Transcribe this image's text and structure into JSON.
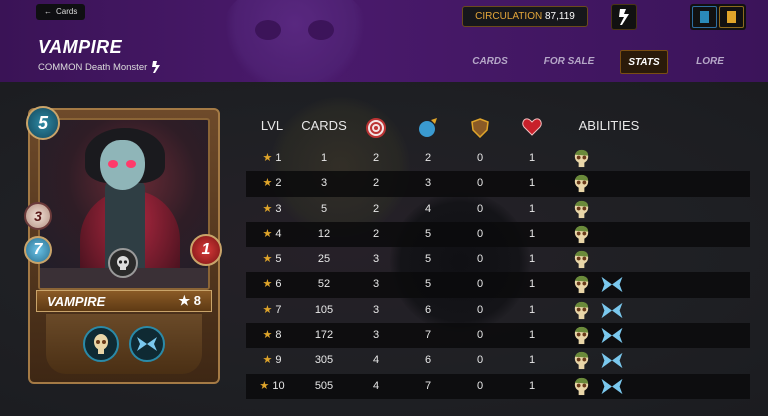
{
  "header": {
    "back_label": "Cards",
    "title": "VAMPIRE",
    "subtitle": "COMMON Death Monster",
    "circulation_label": "CIRCULATION",
    "circulation_value": "87,119",
    "tabs": [
      {
        "label": "CARDS",
        "active": false
      },
      {
        "label": "FOR SALE",
        "active": false
      },
      {
        "label": "STATS",
        "active": true
      },
      {
        "label": "LORE",
        "active": false
      }
    ]
  },
  "card": {
    "mana": "5",
    "attack": "3",
    "speed": "7",
    "health": "1",
    "name": "VAMPIRE",
    "level": "★ 8",
    "abilities": [
      "skull-ability-icon",
      "wings-ability-icon"
    ]
  },
  "table": {
    "headers": {
      "lvl": "LVL",
      "cards": "CARDS",
      "abilities": "ABILITIES"
    },
    "header_icons": [
      "target-icon",
      "speed-orb-icon",
      "shield-icon",
      "heart-icon"
    ],
    "rows": [
      {
        "lvl": "1",
        "cards": "1",
        "attack": "2",
        "speed": "2",
        "armor": "0",
        "health": "1",
        "abilities": [
          "skull"
        ]
      },
      {
        "lvl": "2",
        "cards": "3",
        "attack": "2",
        "speed": "3",
        "armor": "0",
        "health": "1",
        "abilities": [
          "skull"
        ]
      },
      {
        "lvl": "3",
        "cards": "5",
        "attack": "2",
        "speed": "4",
        "armor": "0",
        "health": "1",
        "abilities": [
          "skull"
        ]
      },
      {
        "lvl": "4",
        "cards": "12",
        "attack": "2",
        "speed": "5",
        "armor": "0",
        "health": "1",
        "abilities": [
          "skull"
        ]
      },
      {
        "lvl": "5",
        "cards": "25",
        "attack": "3",
        "speed": "5",
        "armor": "0",
        "health": "1",
        "abilities": [
          "skull"
        ]
      },
      {
        "lvl": "6",
        "cards": "52",
        "attack": "3",
        "speed": "5",
        "armor": "0",
        "health": "1",
        "abilities": [
          "skull",
          "wings"
        ]
      },
      {
        "lvl": "7",
        "cards": "105",
        "attack": "3",
        "speed": "6",
        "armor": "0",
        "health": "1",
        "abilities": [
          "skull",
          "wings"
        ]
      },
      {
        "lvl": "8",
        "cards": "172",
        "attack": "3",
        "speed": "7",
        "armor": "0",
        "health": "1",
        "abilities": [
          "skull",
          "wings"
        ]
      },
      {
        "lvl": "9",
        "cards": "305",
        "attack": "4",
        "speed": "6",
        "armor": "0",
        "health": "1",
        "abilities": [
          "skull",
          "wings"
        ]
      },
      {
        "lvl": "10",
        "cards": "505",
        "attack": "4",
        "speed": "7",
        "armor": "0",
        "health": "1",
        "abilities": [
          "skull",
          "wings"
        ]
      }
    ]
  },
  "colors": {
    "accent": "#e0a52a",
    "header_bg": "#3a1356",
    "active_tab_border": "#7a4e12"
  }
}
